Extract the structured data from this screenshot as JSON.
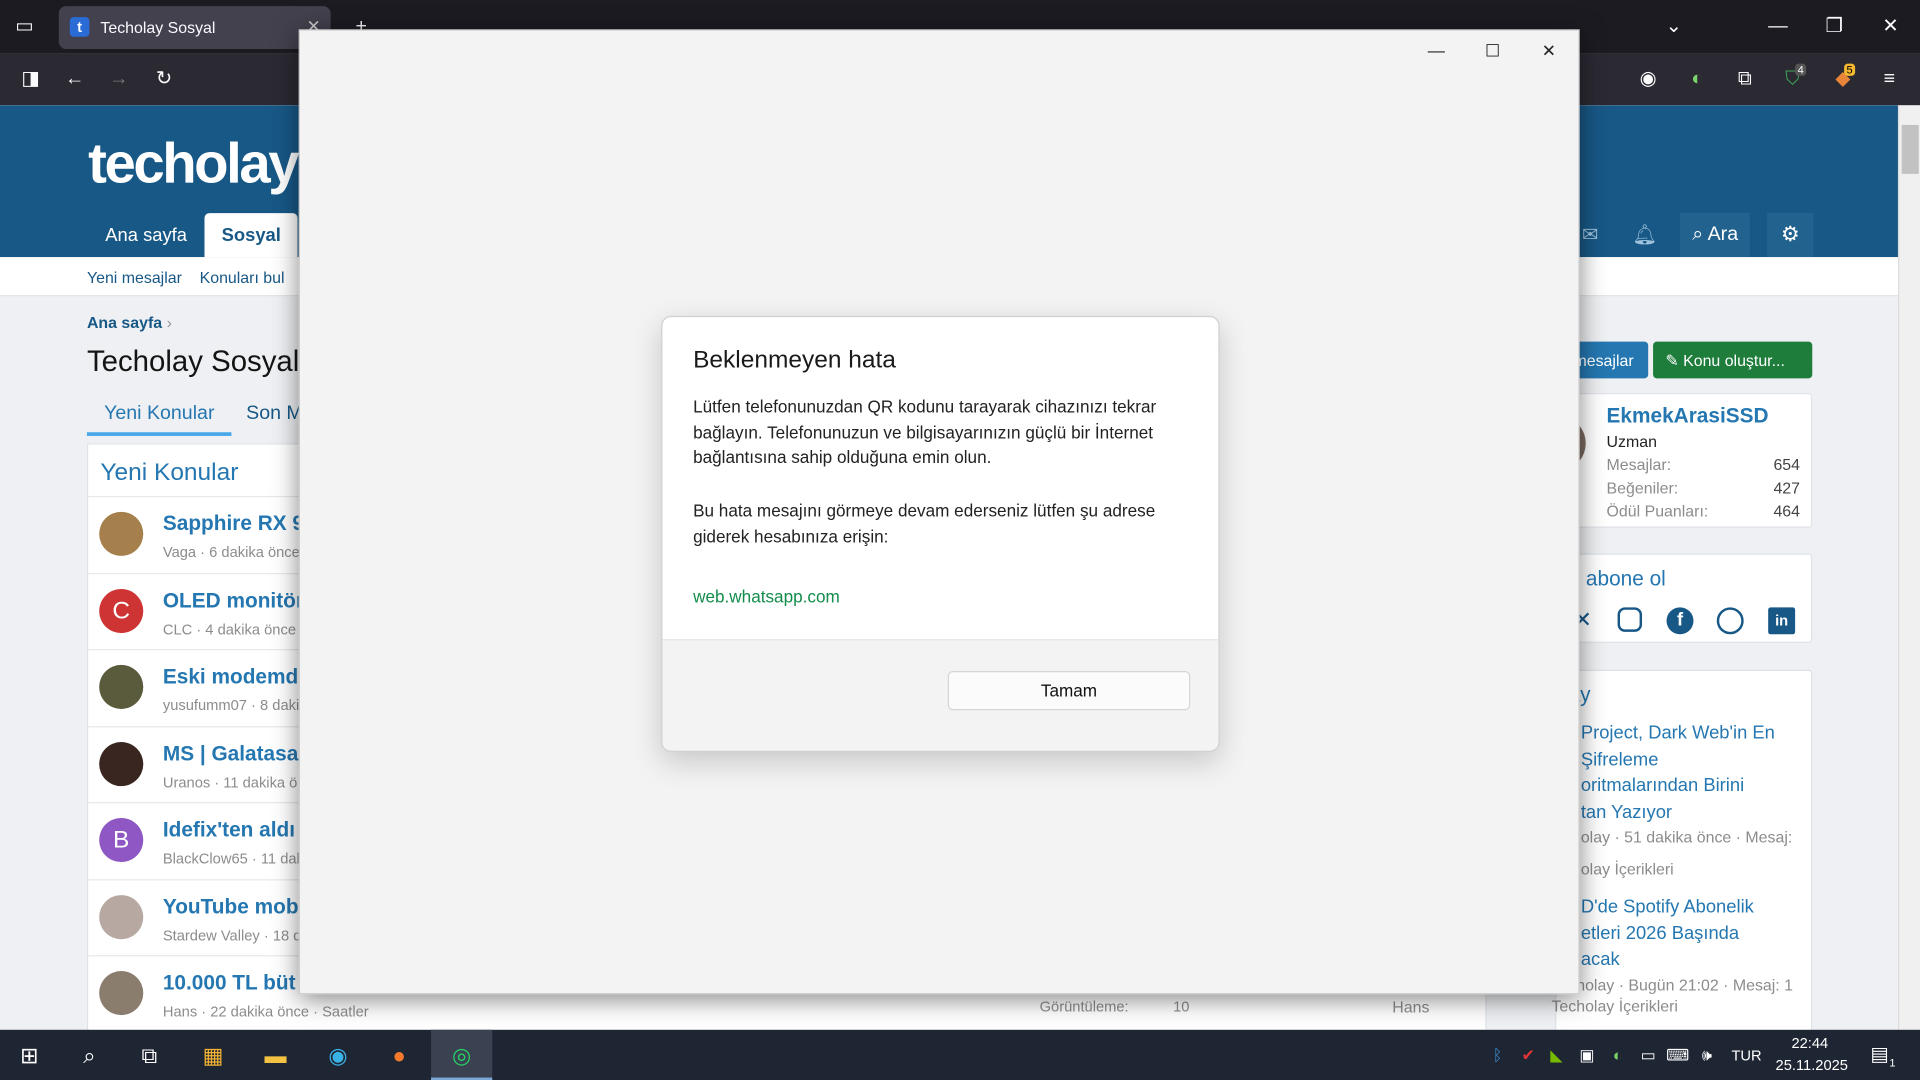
{
  "browser": {
    "tab_title": "Techolay Sosyal",
    "tab_favicon": "t",
    "badge_ext1": "4",
    "badge_ext2": "5"
  },
  "site": {
    "logo_text": "techolay",
    "nav": [
      "Ana sayfa",
      "Sosyal"
    ],
    "nav_search": "Ara",
    "subnav": [
      "Yeni mesajlar",
      "Konuları bul"
    ],
    "breadcrumb": "Ana sayfa",
    "page_title": "Techolay Sosyal",
    "tabs": [
      "Yeni Konular",
      "Son M"
    ],
    "list_title": "Yeni Konular",
    "threads": [
      {
        "title": "Sapphire RX 9",
        "meta": "Vaga · 6 dakika önce",
        "avatar_letter": "",
        "avatar_color": "#a5804c"
      },
      {
        "title": "OLED monitör",
        "meta": "CLC · 4 dakika önce ·",
        "avatar_letter": "C",
        "avatar_color": "#cf3434"
      },
      {
        "title": "Eski modemd",
        "meta": "yusufumm07 · 8 daki",
        "avatar_letter": "",
        "avatar_color": "#5a5a3c"
      },
      {
        "title": "MS | Galatasa",
        "meta": "Uranos · 11 dakika ö",
        "avatar_letter": "",
        "avatar_color": "#3a2620"
      },
      {
        "title": "Idefix'ten aldı",
        "meta": "BlackClow65 · 11 dak",
        "avatar_letter": "B",
        "avatar_color": "#8e57c4"
      },
      {
        "title": "YouTube mob",
        "meta": "Stardew Valley · 18 d",
        "avatar_letter": "",
        "avatar_color": "#b7a9a2"
      },
      {
        "title": "10.000 TL büt",
        "meta": "Hans · 22 dakika önce · Saatler",
        "avatar_letter": "",
        "avatar_color": "#8a7d6e"
      }
    ],
    "last_row_stat_label": "Görüntüleme:",
    "last_row_stat_value": "10",
    "last_row_user": "Hans",
    "btn_messages": "mesajlar",
    "btn_create": "Konu oluştur...",
    "profile": {
      "name": "EkmekArasiSSD",
      "role": "Uzman",
      "stats": [
        {
          "label": "Mesajlar:",
          "value": "654"
        },
        {
          "label": "Beğeniler:",
          "value": "427"
        },
        {
          "label": "Ödül Puanları:",
          "value": "464"
        }
      ]
    },
    "follow_title": "t, abone ol",
    "news_title": "ay",
    "news": [
      {
        "title_lines": [
          "Project, Dark Web'in En",
          "Şifreleme",
          "oritmalarından Birini",
          "tan Yazıyor"
        ],
        "meta": "olay · 51 dakika önce · Mesaj:",
        "cat": "olay İçerikleri"
      },
      {
        "title_lines": [
          "D'de Spotify Abonelik",
          "etleri 2026 Başında",
          "acak"
        ],
        "meta": "Techolay · Bugün 21:02 · Mesaj: 1",
        "cat": "Techolay İçerikleri"
      }
    ]
  },
  "dialog": {
    "title": "Beklenmeyen hata",
    "para1": "Lütfen telefonunuzdan QR kodunu tarayarak cihazınızı tekrar bağlayın. Telefonunuzun ve bilgisayarınızın güçlü bir İnternet bağlantısına sahip olduğuna emin olun.",
    "para2": "Bu hata mesajını görmeye devam ederseniz lütfen şu adrese giderek hesabınıza erişin:",
    "link": "web.whatsapp.com",
    "ok_button": "Tamam"
  },
  "taskbar": {
    "lang": "TUR",
    "time": "22:44",
    "date": "25.11.2025",
    "notif_count": "1"
  },
  "colors": {
    "header": "#185886",
    "accent": "#2577b1",
    "green_btn": "#1e7d3b",
    "whatsapp_link": "#128c4b"
  }
}
